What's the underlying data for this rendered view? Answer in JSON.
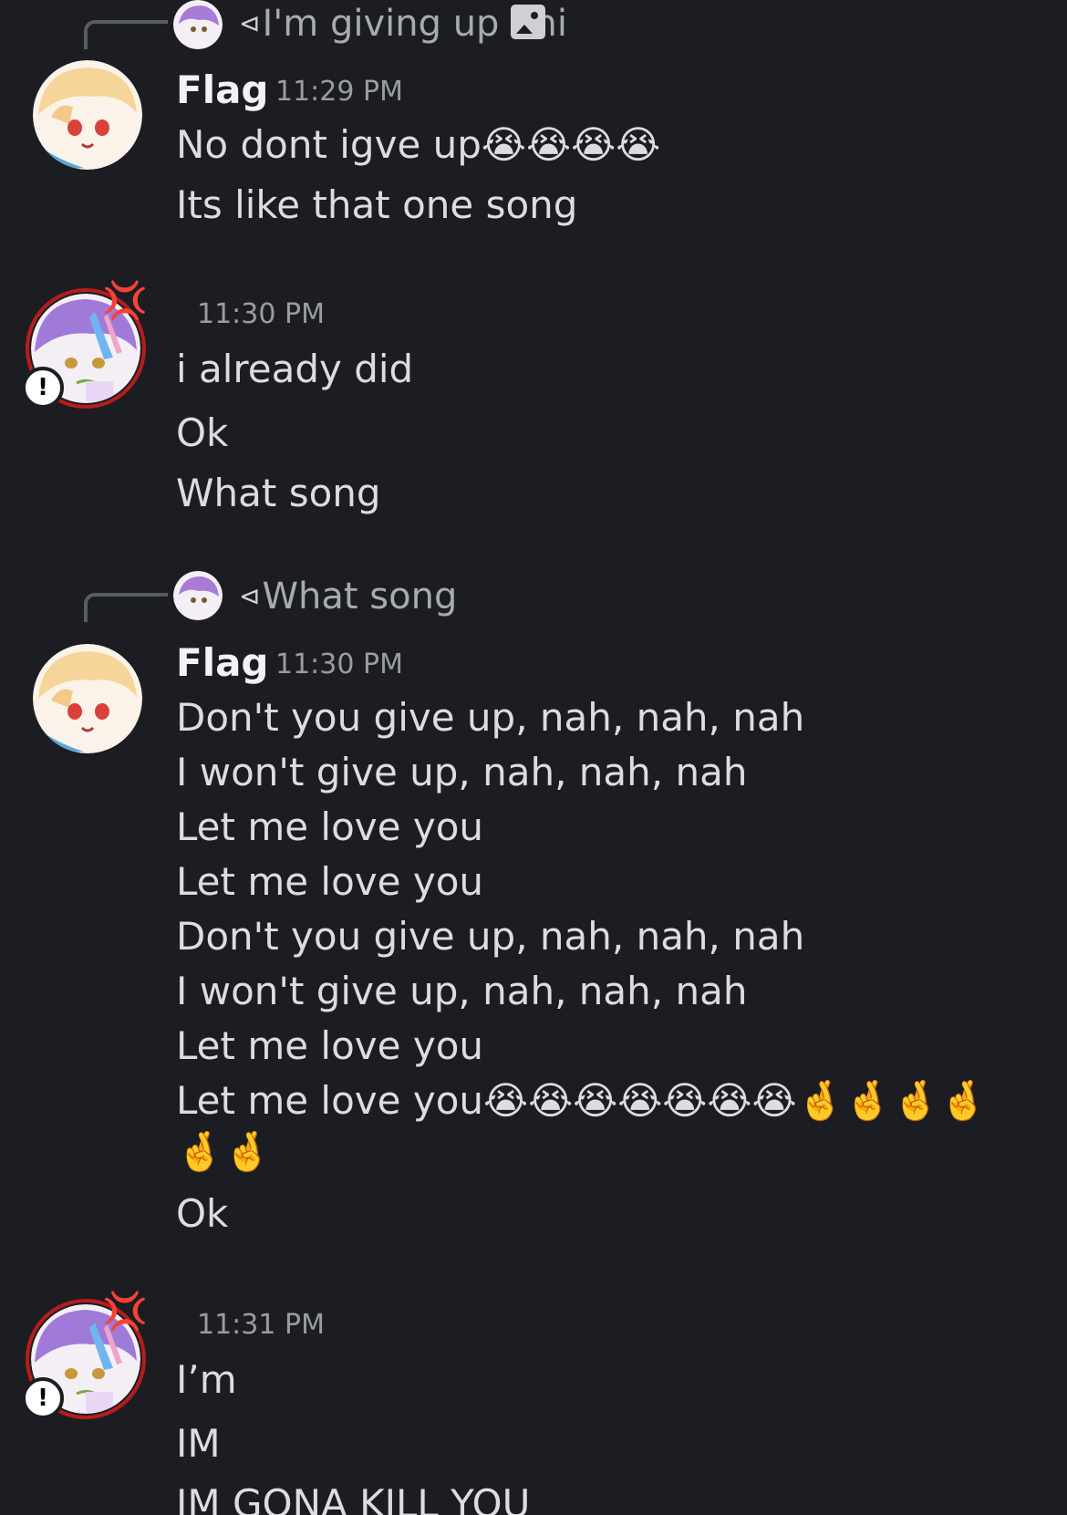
{
  "colors": {
    "background": "#1c1d22",
    "text": "#dcdde1",
    "username": "#f2f3f5",
    "timestamp": "#9a9ca3",
    "reply_line": "#5a5c63",
    "ring": "#b71c1c"
  },
  "icons": {
    "reply_arrow": "reply-arrow-icon",
    "image": "image-icon",
    "warning": "warning-badge-icon"
  },
  "messages": [
    {
      "reply": {
        "text": "I'm giving up dni"
      },
      "username": "Flag",
      "time": "11:29 PM",
      "lines": [
        "No dont igve up😭😭😭😭",
        "Its like that one song"
      ]
    },
    {
      "time": "11:30 PM",
      "lines": [
        "i already did",
        "Ok",
        "What song"
      ]
    },
    {
      "reply": {
        "text": "What song"
      },
      "username": "Flag",
      "time": "11:30 PM",
      "lines": [
        "Don't you give up, nah, nah, nah",
        "I won't give up, nah, nah, nah",
        "Let me love you",
        "Let me love you",
        "Don't you give up, nah, nah, nah",
        "I won't give up, nah, nah, nah",
        "Let me love you",
        "Let me love you😭😭😭😭😭😭😭🤞🤞🤞🤞",
        "🤞🤞",
        "Ok"
      ]
    },
    {
      "time": "11:31 PM",
      "lines": [
        "I’m",
        "IM",
        "IM GONA KILL YOU"
      ]
    }
  ]
}
